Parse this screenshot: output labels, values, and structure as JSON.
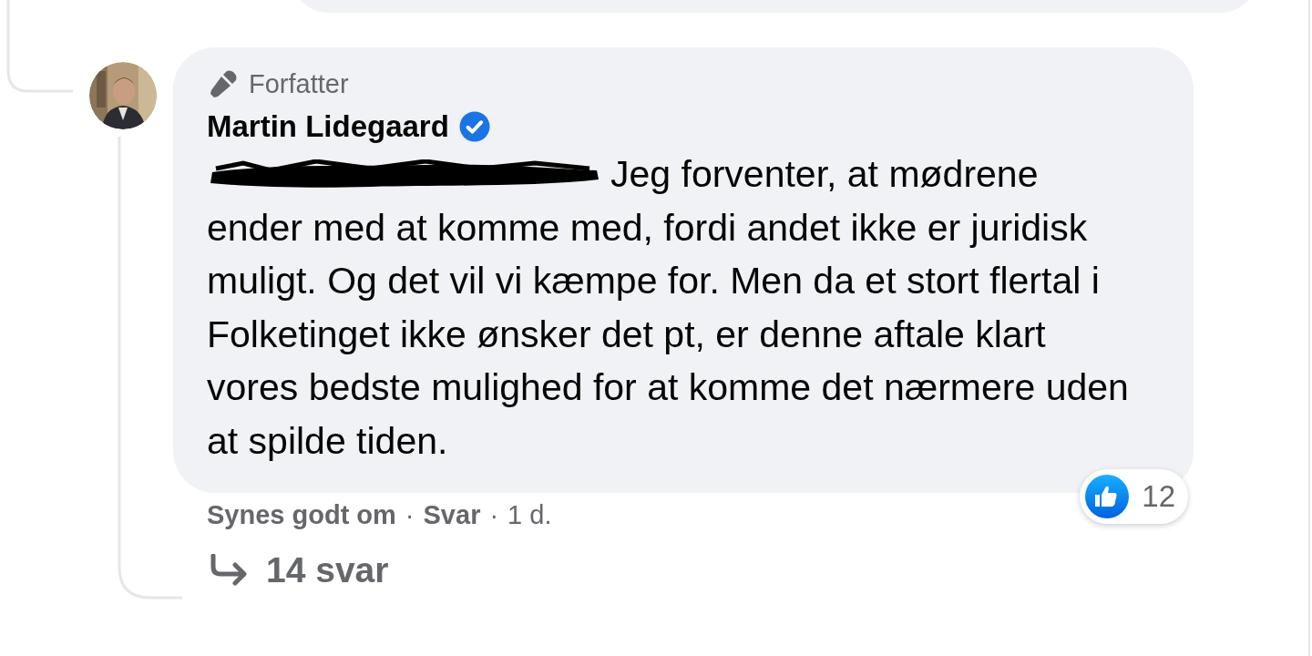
{
  "comment": {
    "badge": "Forfatter",
    "author": "Martin Lidegaard",
    "verified": true,
    "mention_redacted": true,
    "text": "Jeg forventer, at mødrene ender med at komme med, fordi andet ikke er juridisk muligt. Og det vil vi kæmpe for. Men da et stort flertal i Folketinget ikke ønsker det pt, er denne aftale klart vores bedste mulighed for at komme det nærmere uden at spilde tiden.",
    "reactions": {
      "count": "12"
    },
    "separator": "·",
    "actions": [
      {
        "label": "Synes godt om",
        "kind": "link"
      },
      {
        "label": "Svar",
        "kind": "link"
      },
      {
        "label": "1 d.",
        "kind": "time"
      }
    ],
    "replies": "14 svar"
  }
}
